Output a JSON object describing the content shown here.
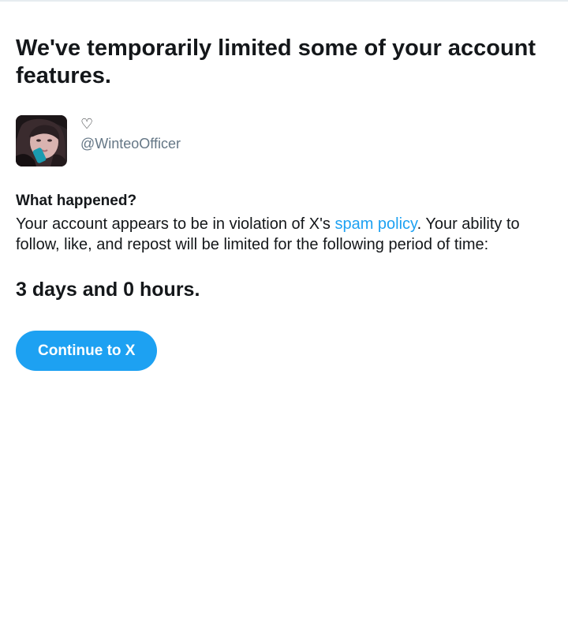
{
  "header": {
    "title": "We've temporarily limited some of your account features."
  },
  "account": {
    "display_name": "♡",
    "handle": "@WinteoOfficer",
    "avatar_icon": "profile-photo"
  },
  "notice": {
    "heading": "What happened?",
    "text_before_link": "Your account appears to be in violation of X's ",
    "link_text": "spam policy",
    "text_after_link": ". Your ability to follow, like, and repost will be limited for the following period of time:",
    "duration": "3 days and 0 hours."
  },
  "actions": {
    "continue_label": "Continue to X"
  },
  "colors": {
    "accent": "#1da1f2",
    "text": "#14171a",
    "muted": "#657786"
  }
}
